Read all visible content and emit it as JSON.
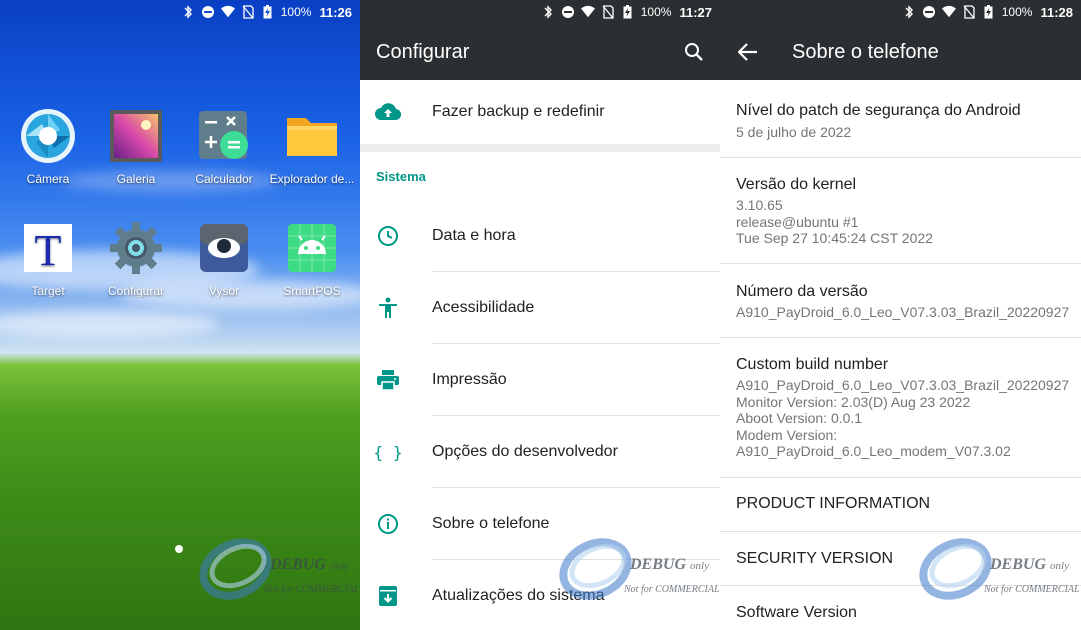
{
  "status": {
    "battery": "100%",
    "time_home": "11:26",
    "time_settings": "11:27",
    "time_about": "11:28"
  },
  "home": {
    "apps": [
      {
        "label": "Câmera",
        "icon": "camera-icon"
      },
      {
        "label": "Galeria",
        "icon": "gallery-icon"
      },
      {
        "label": "Calculador",
        "icon": "calculator-icon"
      },
      {
        "label": "Explorador de...",
        "icon": "folder-icon"
      },
      {
        "label": "Target",
        "icon": "target-app-icon"
      },
      {
        "label": "Configurar",
        "icon": "settings-gear-icon"
      },
      {
        "label": "Vysor",
        "icon": "vysor-icon"
      },
      {
        "label": "SmartPOS",
        "icon": "android-icon"
      }
    ]
  },
  "watermark": {
    "brand": "DEBUG",
    "tag": "only",
    "note": "Not for COMMERCIAL"
  },
  "settings": {
    "title": "Configurar",
    "backup_label": "Fazer backup e redefinir",
    "section_system": "Sistema",
    "items": [
      {
        "label": "Data e hora",
        "icon": "clock-icon"
      },
      {
        "label": "Acessibilidade",
        "icon": "accessibility-icon"
      },
      {
        "label": "Impressão",
        "icon": "print-icon"
      },
      {
        "label": "Opções do desenvolvedor",
        "icon": "code-braces-icon"
      },
      {
        "label": "Sobre o telefone",
        "icon": "info-icon"
      },
      {
        "label": "Atualizações do sistema",
        "icon": "system-update-icon"
      }
    ]
  },
  "about": {
    "title": "Sobre o telefone",
    "items": [
      {
        "title": "Nível do patch de segurança do Android",
        "lines": [
          "5 de julho de 2022"
        ]
      },
      {
        "title": "Versão do kernel",
        "lines": [
          "3.10.65",
          "release@ubuntu #1",
          "Tue Sep 27 10:45:24 CST 2022"
        ]
      },
      {
        "title": "Número da versão",
        "lines": [
          "A910_PayDroid_6.0_Leo_V07.3.03_Brazil_20220927"
        ]
      },
      {
        "title": "Custom build number",
        "lines": [
          "A910_PayDroid_6.0_Leo_V07.3.03_Brazil_20220927",
          "Monitor Version: 2.03(D) Aug 23 2022",
          "Aboot Version: 0.0.1",
          "Modem Version:",
          "A910_PayDroid_6.0_Leo_modem_V07.3.02"
        ]
      },
      {
        "title": "PRODUCT INFORMATION",
        "lines": []
      },
      {
        "title": "SECURITY VERSION",
        "lines": []
      },
      {
        "title": "Software Version",
        "lines": []
      }
    ]
  },
  "colors": {
    "accent": "#009688",
    "appbar": "#2b2f31",
    "divider": "#e0e0e0"
  }
}
